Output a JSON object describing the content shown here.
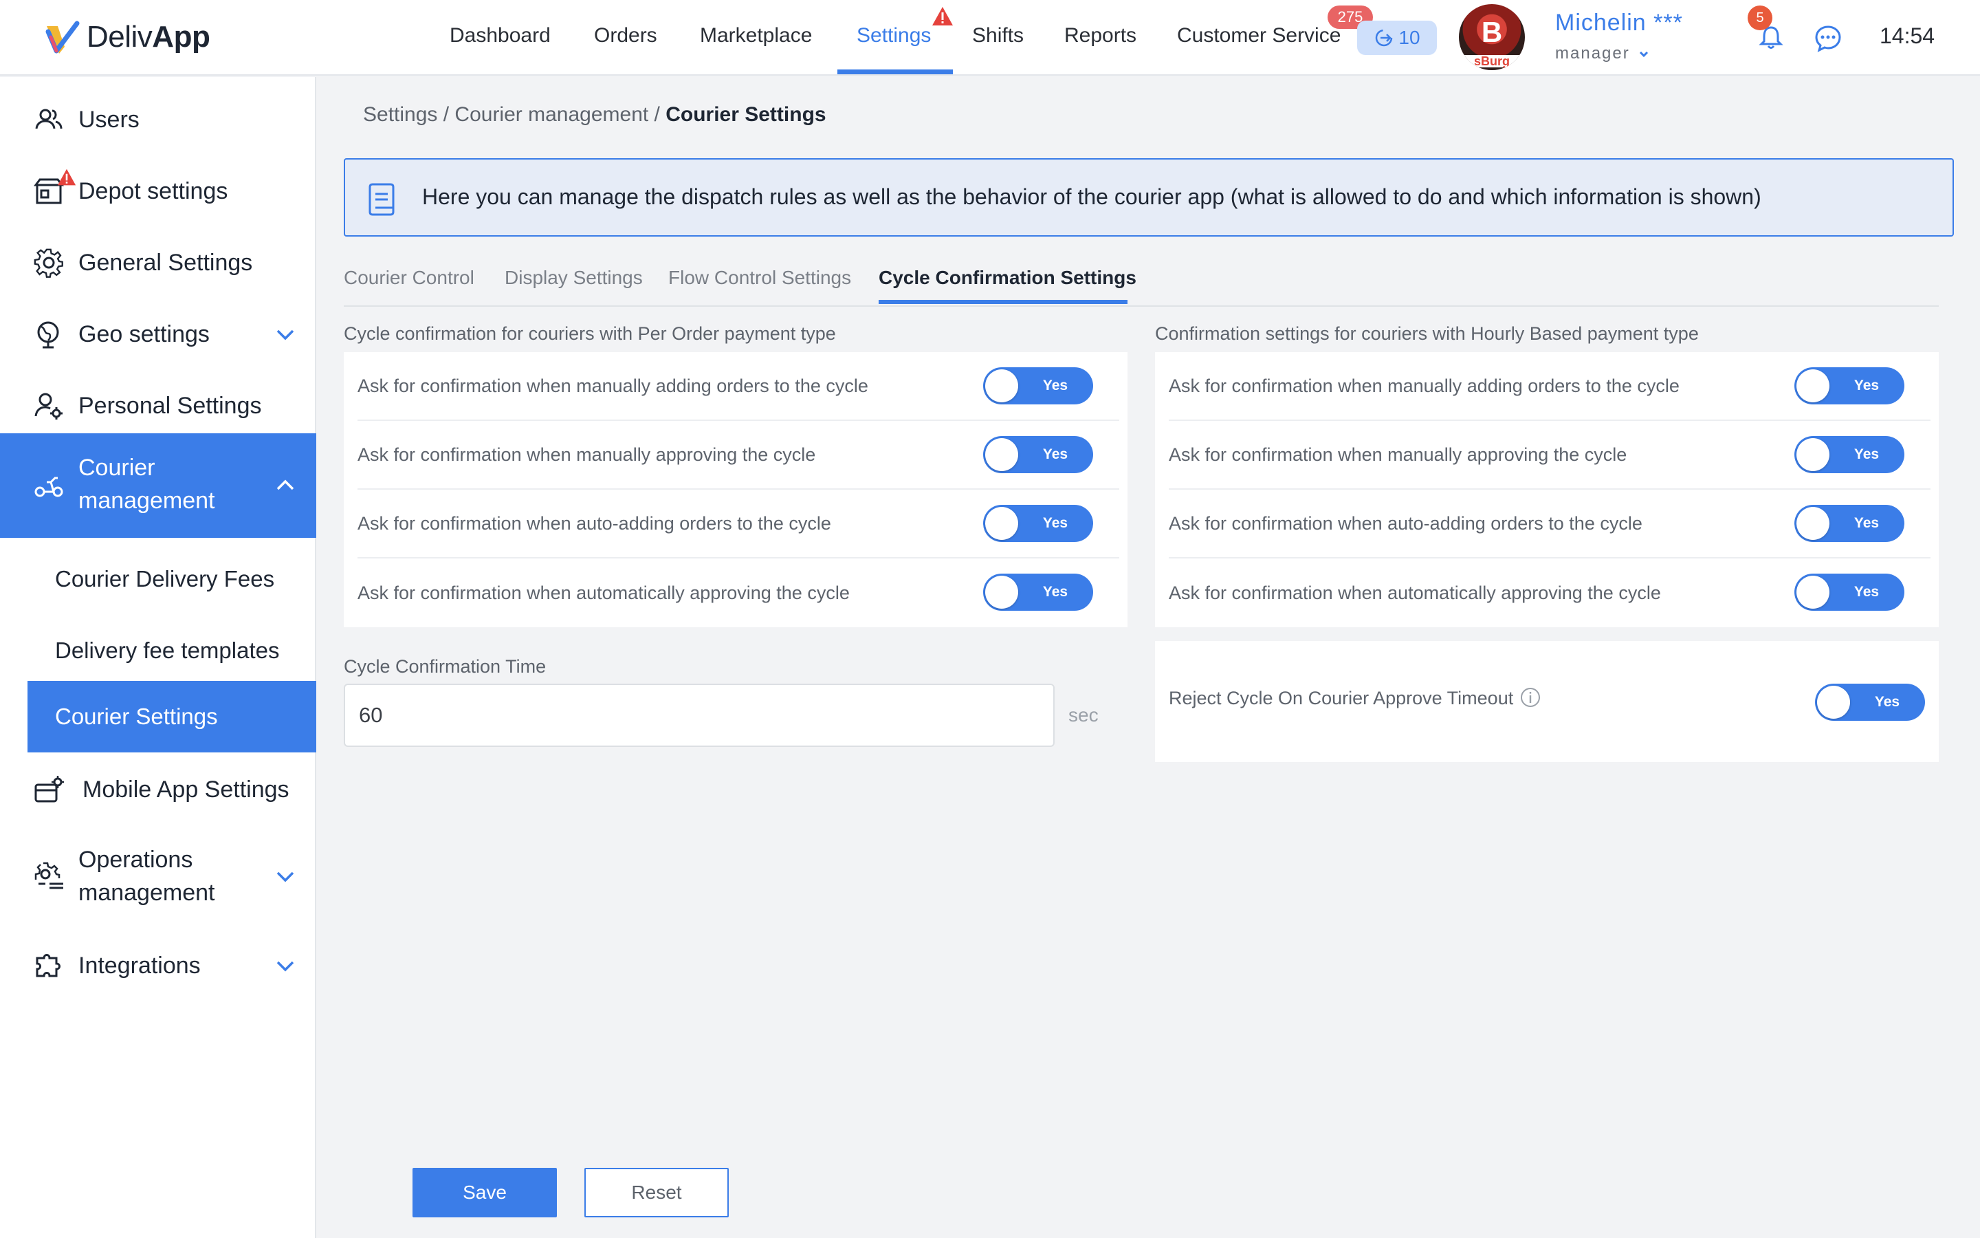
{
  "app": {
    "logo_text_a": "Deliv",
    "logo_text_b": "App"
  },
  "nav": {
    "dashboard": "Dashboard",
    "orders": "Orders",
    "marketplace": "Marketplace",
    "settings": "Settings",
    "shifts": "Shifts",
    "reports": "Reports",
    "customer_service": "Customer Service",
    "customer_service_count": "275",
    "pill_count": "10"
  },
  "user": {
    "avatar_letter": "B",
    "avatar_sub": "sBurg",
    "name": "Michelin ***",
    "role": "manager",
    "notifications": "5",
    "time": "14:54"
  },
  "sidebar": {
    "users": "Users",
    "depot": "Depot settings",
    "general": "General Settings",
    "geo": "Geo settings",
    "personal": "Personal Settings",
    "courier_mgmt_1": "Courier",
    "courier_mgmt_2": "management",
    "courier_fees": "Courier Delivery Fees",
    "fee_templates": "Delivery fee templates",
    "courier_settings": "Courier Settings",
    "mobile_app": "Mobile App Settings",
    "operations_1": "Operations",
    "operations_2": "management",
    "integrations": "Integrations"
  },
  "breadcrumb": {
    "part1": "Settings / Courier management / ",
    "current": "Courier Settings"
  },
  "info": "Here you can manage the dispatch rules as well as the behavior of the courier app (what is allowed to do and which information is shown)",
  "tabs": {
    "courier_control": "Courier Control",
    "display": "Display Settings",
    "flow": "Flow Control Settings",
    "cycle": "Cycle Confirmation Settings"
  },
  "left_section": {
    "title": "Cycle confirmation for couriers with Per Order payment type",
    "rows": [
      {
        "label": "Ask for confirmation when manually adding orders to the cycle",
        "value": "Yes"
      },
      {
        "label": "Ask for confirmation when manually approving the cycle",
        "value": "Yes"
      },
      {
        "label": "Ask for confirmation when auto-adding orders to the cycle",
        "value": "Yes"
      },
      {
        "label": "Ask for confirmation when automatically approving the cycle",
        "value": "Yes"
      }
    ]
  },
  "right_section": {
    "title": "Confirmation settings for couriers with Hourly Based payment type",
    "rows": [
      {
        "label": "Ask for confirmation when manually adding orders to the cycle",
        "value": "Yes"
      },
      {
        "label": "Ask for confirmation when manually approving the cycle",
        "value": "Yes"
      },
      {
        "label": "Ask for confirmation when auto-adding orders to the cycle",
        "value": "Yes"
      },
      {
        "label": "Ask for confirmation when automatically approving the cycle",
        "value": "Yes"
      }
    ]
  },
  "cycle_time": {
    "label": "Cycle Confirmation Time",
    "value": "60",
    "unit": "sec"
  },
  "reject": {
    "label": "Reject Cycle On Courier Approve Timeout",
    "value": "Yes"
  },
  "buttons": {
    "save": "Save",
    "reset": "Reset"
  },
  "colors": {
    "accent": "#3b7de8",
    "badge_red": "#e86464",
    "info_bg": "#e6ecf7"
  }
}
